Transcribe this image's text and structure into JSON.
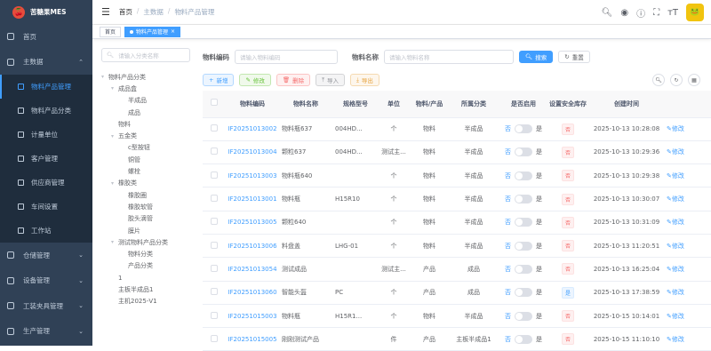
{
  "app": {
    "name": "苦糖果MES"
  },
  "sidebar": {
    "items": [
      {
        "label": "首页"
      },
      {
        "label": "主数据",
        "arrow": "⌃"
      }
    ],
    "subitems": [
      {
        "label": "物料产品管理",
        "active": true
      },
      {
        "label": "物料产品分类"
      },
      {
        "label": "计量单位"
      },
      {
        "label": "客户管理"
      },
      {
        "label": "供应商管理"
      },
      {
        "label": "车间设置"
      },
      {
        "label": "工作站"
      }
    ],
    "bottom": [
      {
        "label": "仓储管理",
        "arrow": "⌄"
      },
      {
        "label": "设备管理",
        "arrow": "⌄"
      },
      {
        "label": "工装夹具管理",
        "arrow": "⌄"
      },
      {
        "label": "生产管理",
        "arrow": "⌄"
      }
    ]
  },
  "breadcrumb": [
    "首页",
    "主数据",
    "物料产品管理"
  ],
  "tabs": [
    {
      "label": "首页"
    },
    {
      "label": "物料产品管理",
      "close": "×"
    }
  ],
  "tree": {
    "search_placeholder": "请输入分类名称",
    "nodes": [
      {
        "label": "物料产品分类",
        "level": 0,
        "caret": "▾"
      },
      {
        "label": "成品盒",
        "level": 1,
        "caret": "▾"
      },
      {
        "label": "半成品",
        "level": 2
      },
      {
        "label": "成品",
        "level": 2
      },
      {
        "label": "物料",
        "level": 1
      },
      {
        "label": "五金类",
        "level": 1,
        "caret": "▾"
      },
      {
        "label": "c型按钮",
        "level": 2
      },
      {
        "label": "铜管",
        "level": 2
      },
      {
        "label": "螺栓",
        "level": 2
      },
      {
        "label": "橡胶类",
        "level": 1,
        "caret": "▾"
      },
      {
        "label": "橡胶圈",
        "level": 2
      },
      {
        "label": "橡胶软管",
        "level": 2
      },
      {
        "label": "胶头滴管",
        "level": 2
      },
      {
        "label": "膜片",
        "level": 2
      },
      {
        "label": "测试物料产品分类",
        "level": 1,
        "caret": "▾"
      },
      {
        "label": "物料分类",
        "level": 2
      },
      {
        "label": "产品分类",
        "level": 2
      },
      {
        "label": "1",
        "level": 1
      },
      {
        "label": "主板半成品1",
        "level": 1
      },
      {
        "label": "主机2025-V1",
        "level": 1
      }
    ]
  },
  "filters": {
    "code_label": "物料编码",
    "code_placeholder": "请输入物料编码",
    "name_label": "物料名称",
    "name_placeholder": "请输入物料名称",
    "search_label": "搜索",
    "reset_label": "重置"
  },
  "actions": {
    "add": "新增",
    "edit": "修改",
    "delete": "删除",
    "import": "导入",
    "export": "导出"
  },
  "table": {
    "headers": [
      "物料编码",
      "物料名称",
      "规格型号",
      "单位",
      "物料/产品",
      "所属分类",
      "是否启用",
      "设置安全库存",
      "创建时间",
      ""
    ],
    "yes": "是",
    "no": "否",
    "edit_label": "修改",
    "rows": [
      {
        "code": "IF20251013002",
        "name": "物料瓶637",
        "spec": "004HD...",
        "unit": "个",
        "type": "物料",
        "category": "半成品",
        "safe": "否",
        "safe_color": "red",
        "created": "2025-10-13 10:28:08"
      },
      {
        "code": "IF20251013004",
        "name": "颗粒637",
        "spec": "004HD...",
        "unit": "测试主...",
        "type": "物料",
        "category": "半成品",
        "safe": "否",
        "safe_color": "red",
        "created": "2025-10-13 10:29:36"
      },
      {
        "code": "IF20251013003",
        "name": "物料瓶640",
        "spec": "",
        "unit": "个",
        "type": "物料",
        "category": "半成品",
        "safe": "否",
        "safe_color": "red",
        "created": "2025-10-13 10:29:38"
      },
      {
        "code": "IF20251013001",
        "name": "物料瓶",
        "spec": "H15R10",
        "unit": "个",
        "type": "物料",
        "category": "半成品",
        "safe": "否",
        "safe_color": "red",
        "created": "2025-10-13 10:30:07"
      },
      {
        "code": "IF20251013005",
        "name": "颗粒640",
        "spec": "",
        "unit": "个",
        "type": "物料",
        "category": "半成品",
        "safe": "否",
        "safe_color": "red",
        "created": "2025-10-13 10:31:09"
      },
      {
        "code": "IF20251013006",
        "name": "料盘盖",
        "spec": "LHG-01",
        "unit": "个",
        "type": "物料",
        "category": "半成品",
        "safe": "否",
        "safe_color": "red",
        "created": "2025-10-13 11:20:51"
      },
      {
        "code": "IF20251013054",
        "name": "测试成品",
        "spec": "",
        "unit": "测试主...",
        "type": "产品",
        "category": "成品",
        "safe": "否",
        "safe_color": "red",
        "created": "2025-10-13 16:25:04"
      },
      {
        "code": "IF20251013060",
        "name": "智能头盔",
        "spec": "PC",
        "unit": "个",
        "type": "产品",
        "category": "成品",
        "safe": "是",
        "safe_color": "blue",
        "created": "2025-10-13 17:38:59"
      },
      {
        "code": "IF20251015003",
        "name": "物料瓶",
        "spec": "H15R1...",
        "unit": "个",
        "type": "物料",
        "category": "半成品",
        "safe": "否",
        "safe_color": "red",
        "created": "2025-10-15 10:14:01"
      },
      {
        "code": "IF20251015005",
        "name": "刚刚测试产品",
        "spec": "",
        "unit": "件",
        "type": "产品",
        "category": "主板半成品1",
        "safe": "否",
        "safe_color": "red",
        "created": "2025-10-15 11:10:10"
      }
    ]
  },
  "colors": {
    "sidebar": "#304156",
    "accent": "#409eff"
  }
}
